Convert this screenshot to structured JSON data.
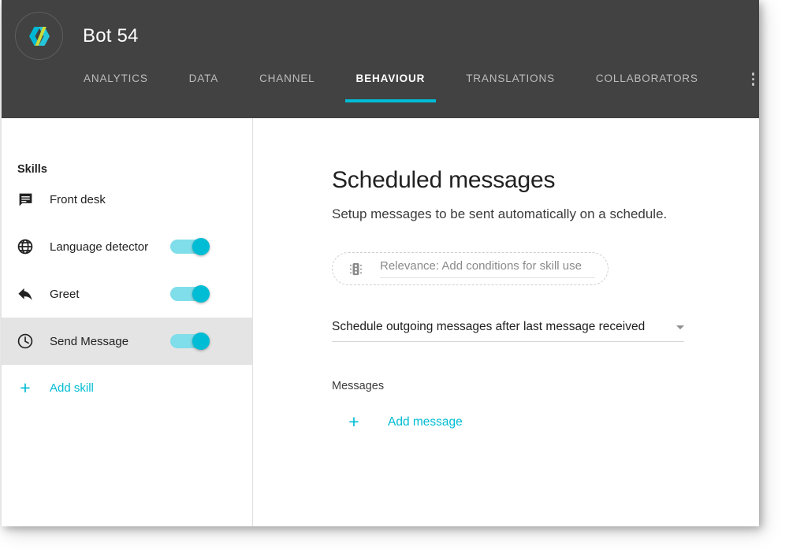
{
  "header": {
    "bot_name": "Bot 54",
    "logo_icon": "bot-logo-icon",
    "logo_colors": {
      "cyan": "#00b8d4",
      "teal": "#26c6da",
      "lime": "#cddc39"
    },
    "accent_color": "#00bcd4",
    "background_color": "#424242",
    "tabs": [
      {
        "label": "ANALYTICS",
        "active": false
      },
      {
        "label": "DATA",
        "active": false
      },
      {
        "label": "CHANNEL",
        "active": false
      },
      {
        "label": "BEHAVIOUR",
        "active": true
      },
      {
        "label": "TRANSLATIONS",
        "active": false
      },
      {
        "label": "COLLABORATORS",
        "active": false
      }
    ],
    "overflow_menu_icon": "more-vertical-icon"
  },
  "sidebar": {
    "title": "Skills",
    "items": [
      {
        "label": "Front desk",
        "icon": "chat-bubble-icon",
        "has_toggle": false,
        "toggle_on": false,
        "selected": false
      },
      {
        "label": "Language detector",
        "icon": "globe-icon",
        "has_toggle": true,
        "toggle_on": true,
        "selected": false
      },
      {
        "label": "Greet",
        "icon": "reply-arrow-icon",
        "has_toggle": true,
        "toggle_on": true,
        "selected": false
      },
      {
        "label": "Send Message",
        "icon": "clock-icon",
        "has_toggle": true,
        "toggle_on": true,
        "selected": true
      }
    ],
    "add_skill": {
      "label": "Add skill",
      "icon": "plus-icon"
    },
    "selected_row_color": "#e4e4e4",
    "link_color": "#00bcd4"
  },
  "main": {
    "title": "Scheduled messages",
    "subtitle": "Setup messages to be sent automatically on a schedule.",
    "relevance": {
      "icon": "traffic-light-icon",
      "placeholder": "Relevance: Add conditions for skill use"
    },
    "schedule_select": {
      "value": "Schedule outgoing messages after last message received",
      "caret_icon": "chevron-down-icon"
    },
    "messages_label": "Messages",
    "add_message": {
      "label": "Add message",
      "icon": "plus-icon"
    }
  }
}
